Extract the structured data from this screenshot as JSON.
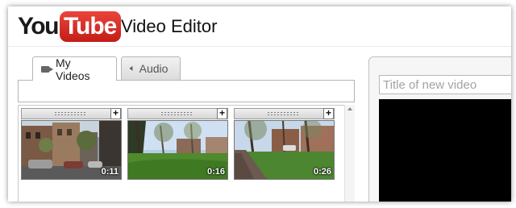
{
  "header": {
    "logo_you": "You",
    "logo_tube": "Tube",
    "title": "Video Editor"
  },
  "tabs": [
    {
      "label": "My Videos",
      "icon": "video-camera-icon",
      "active": true
    },
    {
      "label": "Audio",
      "icon": "speaker-icon",
      "active": false
    }
  ],
  "clips": [
    {
      "duration": "0:11",
      "scene": "street-with-parked-cars"
    },
    {
      "duration": "0:16",
      "scene": "park-lawn-with-trees"
    },
    {
      "duration": "0:26",
      "scene": "sidewalk-with-trees"
    }
  ],
  "editor": {
    "title_placeholder": "Title of new video"
  },
  "colors": {
    "logo_red": "#d52a24",
    "player_background": "#000000"
  }
}
